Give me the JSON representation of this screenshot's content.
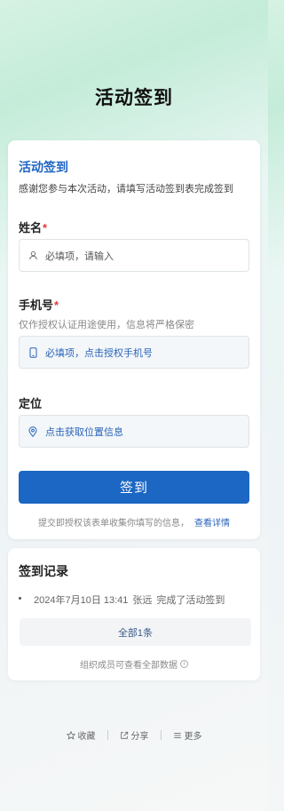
{
  "page": {
    "title": "活动签到"
  },
  "form": {
    "heading": "活动签到",
    "description": "感谢您参与本次活动，请填写活动签到表完成签到",
    "name_field": {
      "label": "姓名",
      "required_mark": "*",
      "placeholder": "必填项，请输入"
    },
    "phone_field": {
      "label": "手机号",
      "required_mark": "*",
      "hint": "仅作授权认证用途使用，信息将严格保密",
      "action_text": "必填项，点击授权手机号"
    },
    "location_field": {
      "label": "定位",
      "action_text": "点击获取位置信息"
    },
    "submit_label": "签到",
    "consent_text": "提交即授权该表单收集你填写的信息，",
    "consent_link": "查看详情"
  },
  "records": {
    "title": "签到记录",
    "items": [
      {
        "time": "2024年7月10日 13:41",
        "user": "张远",
        "action": "完成了活动签到"
      }
    ],
    "all_button": "全部1条",
    "note": "组织成员可查看全部数据",
    "note_icon": "info-icon"
  },
  "footer": {
    "favorite": "收藏",
    "share": "分享",
    "more": "更多"
  }
}
